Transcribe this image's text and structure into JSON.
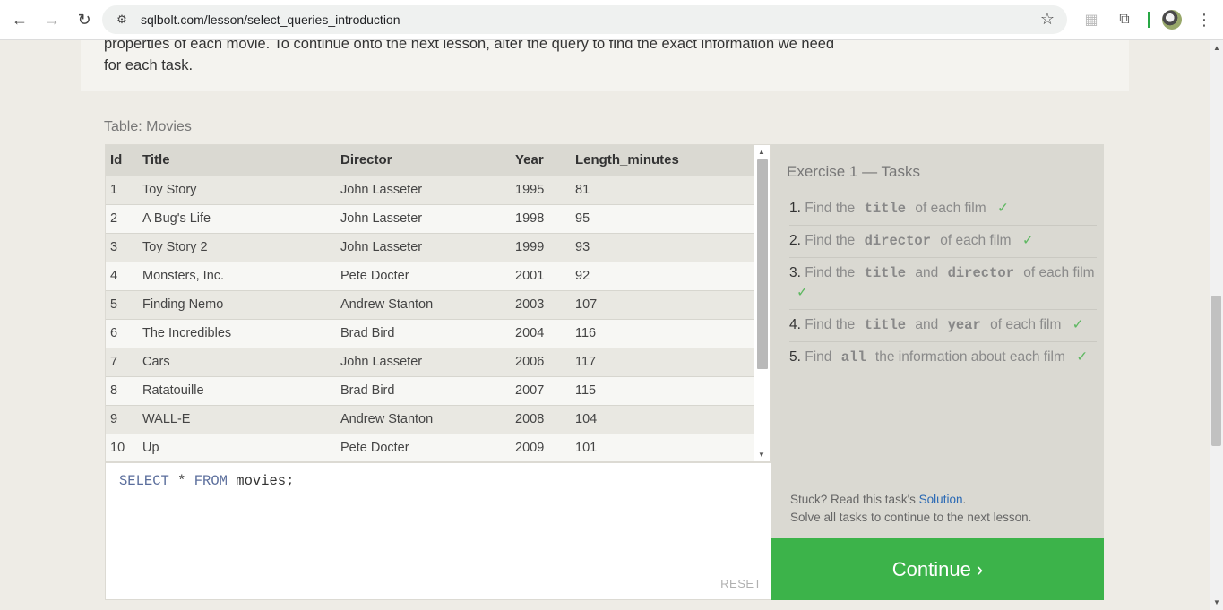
{
  "browser": {
    "url": "sqlbolt.com/lesson/select_queries_introduction",
    "back_icon": "←",
    "forward_icon": "→",
    "reload_icon": "↻",
    "site_info_icon": "⚙",
    "star_icon": "☆",
    "ext_icon_1": "▦",
    "ext_icon_2": "⧉",
    "menu_icon": "⋮"
  },
  "intro": {
    "text": "properties of each movie. To continue onto the next lesson, alter the query to find the exact information we need for each task."
  },
  "table": {
    "caption": "Table: Movies",
    "columns": [
      "Id",
      "Title",
      "Director",
      "Year",
      "Length_minutes"
    ],
    "rows": [
      [
        "1",
        "Toy Story",
        "John Lasseter",
        "1995",
        "81"
      ],
      [
        "2",
        "A Bug's Life",
        "John Lasseter",
        "1998",
        "95"
      ],
      [
        "3",
        "Toy Story 2",
        "John Lasseter",
        "1999",
        "93"
      ],
      [
        "4",
        "Monsters, Inc.",
        "Pete Docter",
        "2001",
        "92"
      ],
      [
        "5",
        "Finding Nemo",
        "Andrew Stanton",
        "2003",
        "107"
      ],
      [
        "6",
        "The Incredibles",
        "Brad Bird",
        "2004",
        "116"
      ],
      [
        "7",
        "Cars",
        "John Lasseter",
        "2006",
        "117"
      ],
      [
        "8",
        "Ratatouille",
        "Brad Bird",
        "2007",
        "115"
      ],
      [
        "9",
        "WALL-E",
        "Andrew Stanton",
        "2008",
        "104"
      ],
      [
        "10",
        "Up",
        "Pete Docter",
        "2009",
        "101"
      ]
    ]
  },
  "editor": {
    "kw_select": "SELECT",
    "star": "*",
    "kw_from": "FROM",
    "rest": "movies;",
    "reset_label": "RESET"
  },
  "tasks": {
    "title": "Exercise 1 — Tasks",
    "items": [
      {
        "num": "1.",
        "before": "Find the",
        "code": "title",
        "between": "",
        "code2": "",
        "after": "of each film",
        "check": "✓"
      },
      {
        "num": "2.",
        "before": "Find the",
        "code": "director",
        "between": "",
        "code2": "",
        "after": "of each film",
        "check": "✓"
      },
      {
        "num": "3.",
        "before": "Find the",
        "code": "title",
        "between": "and",
        "code2": "director",
        "after": "of each film",
        "check": "✓"
      },
      {
        "num": "4.",
        "before": "Find the",
        "code": "title",
        "between": "and",
        "code2": "year",
        "after": "of each film",
        "check": "✓"
      },
      {
        "num": "5.",
        "before": "Find",
        "code": "all",
        "between": "",
        "code2": "",
        "after": "the information about each film",
        "check": "✓"
      }
    ],
    "stuck_text": "Stuck? Read this task's",
    "solution_link": "Solution",
    "stuck_period": ".",
    "solve_text": "Solve all tasks to continue to the next lesson.",
    "continue_label": "Continue ›"
  }
}
